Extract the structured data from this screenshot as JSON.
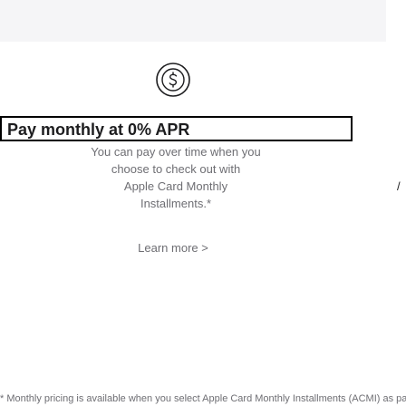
{
  "colors": {
    "background": "#ffffff",
    "topbar": "#f5f5f7",
    "headline": "#1d1d1f",
    "body_text": "#6e6e73",
    "highlight_border": "#000000"
  },
  "icon": {
    "name": "dollar-circle-icon"
  },
  "feature": {
    "headline": "Pay monthly at 0% APR",
    "body_lines": [
      "You can pay over time when you",
      "choose to check out with",
      "Apple Card Monthly",
      "Installments.*"
    ],
    "edge_fragment": "/",
    "link_label": "Learn more >"
  },
  "footnote": "* Monthly pricing is available when you select Apple Card Monthly Installments (ACMI) as payment type at checkout at Apple"
}
